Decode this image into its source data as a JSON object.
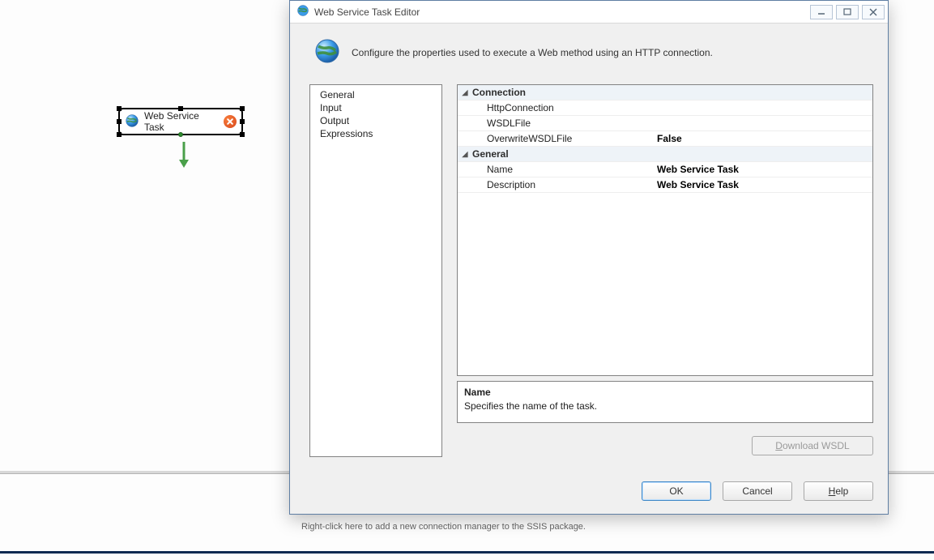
{
  "canvas": {
    "task_label": "Web Service Task",
    "cm_hint": "Right-click here to add a new connection manager to the SSIS package."
  },
  "dialog": {
    "title": "Web Service Task Editor",
    "description": "Configure the properties used to execute a Web method using an HTTP connection.",
    "nav": {
      "items": [
        "General",
        "Input",
        "Output",
        "Expressions"
      ],
      "selected": "General"
    },
    "grid": {
      "categories": [
        {
          "name": "Connection",
          "props": [
            {
              "name": "HttpConnection",
              "value": ""
            },
            {
              "name": "WSDLFile",
              "value": ""
            },
            {
              "name": "OverwriteWSDLFile",
              "value": "False"
            }
          ]
        },
        {
          "name": "General",
          "props": [
            {
              "name": "Name",
              "value": "Web Service Task"
            },
            {
              "name": "Description",
              "value": "Web Service Task"
            }
          ]
        }
      ]
    },
    "help": {
      "name": "Name",
      "desc": "Specifies the name of the task."
    },
    "buttons": {
      "download": "Download WSDL",
      "ok": "OK",
      "cancel": "Cancel",
      "help": "Help"
    }
  }
}
